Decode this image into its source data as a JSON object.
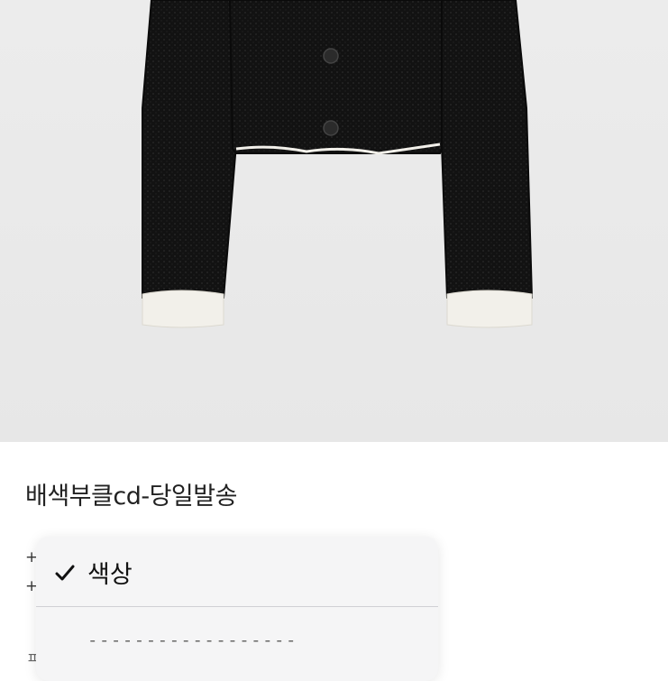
{
  "product": {
    "title": "배색부클cd-당일발송"
  },
  "options_list": {
    "plus_markers": [
      "+",
      "+"
    ],
    "partial_char": "ㅍ"
  },
  "dropdown": {
    "selected_option": "색상",
    "placeholder_option": "------------------",
    "check_icon": "checkmark-icon"
  },
  "colors": {
    "photo_background": "#e9e9e9",
    "cardigan": "#111111",
    "trim": "#f2f0ea",
    "menu_background": "#f5f5f6"
  }
}
